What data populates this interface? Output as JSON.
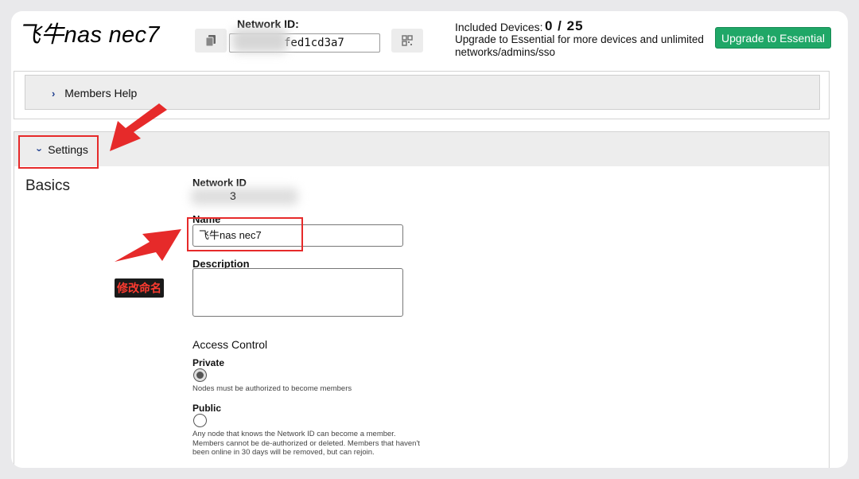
{
  "header": {
    "network_name": "飞牛nas nec7",
    "network_id_label": "Network ID:",
    "network_id_value": "fed1cd3a7",
    "included_devices_label": "Included Devices:",
    "included_devices_count": "0 / 25",
    "upgrade_message": "Upgrade to Essential for more devices and unlimited networks/admins/sso",
    "upgrade_button": "Upgrade to Essential",
    "copy_icon": "copy-icon",
    "qr_icon": "qr-code-icon"
  },
  "members_help": {
    "label": "Members Help",
    "icon": "chevron-right-icon"
  },
  "settings": {
    "label": "Settings",
    "icon": "chevron-down-icon",
    "section_title": "Basics",
    "network_id_label": "Network ID",
    "network_id_value": "3",
    "name_label": "Name",
    "name_value": "飞牛nas nec7",
    "description_label": "Description",
    "description_value": "",
    "access_control_title": "Access Control",
    "options": [
      {
        "label": "Private",
        "selected": true,
        "help": "Nodes must be authorized to become members"
      },
      {
        "label": "Public",
        "selected": false,
        "help": "Any node that knows the Network ID can become a member. Members cannot be de-authorized or deleted. Members that haven't been online in 30 days will be removed, but can rejoin."
      }
    ]
  },
  "annotations": {
    "rename_tag": "修改命名",
    "arrow_color": "#e62a2a"
  }
}
